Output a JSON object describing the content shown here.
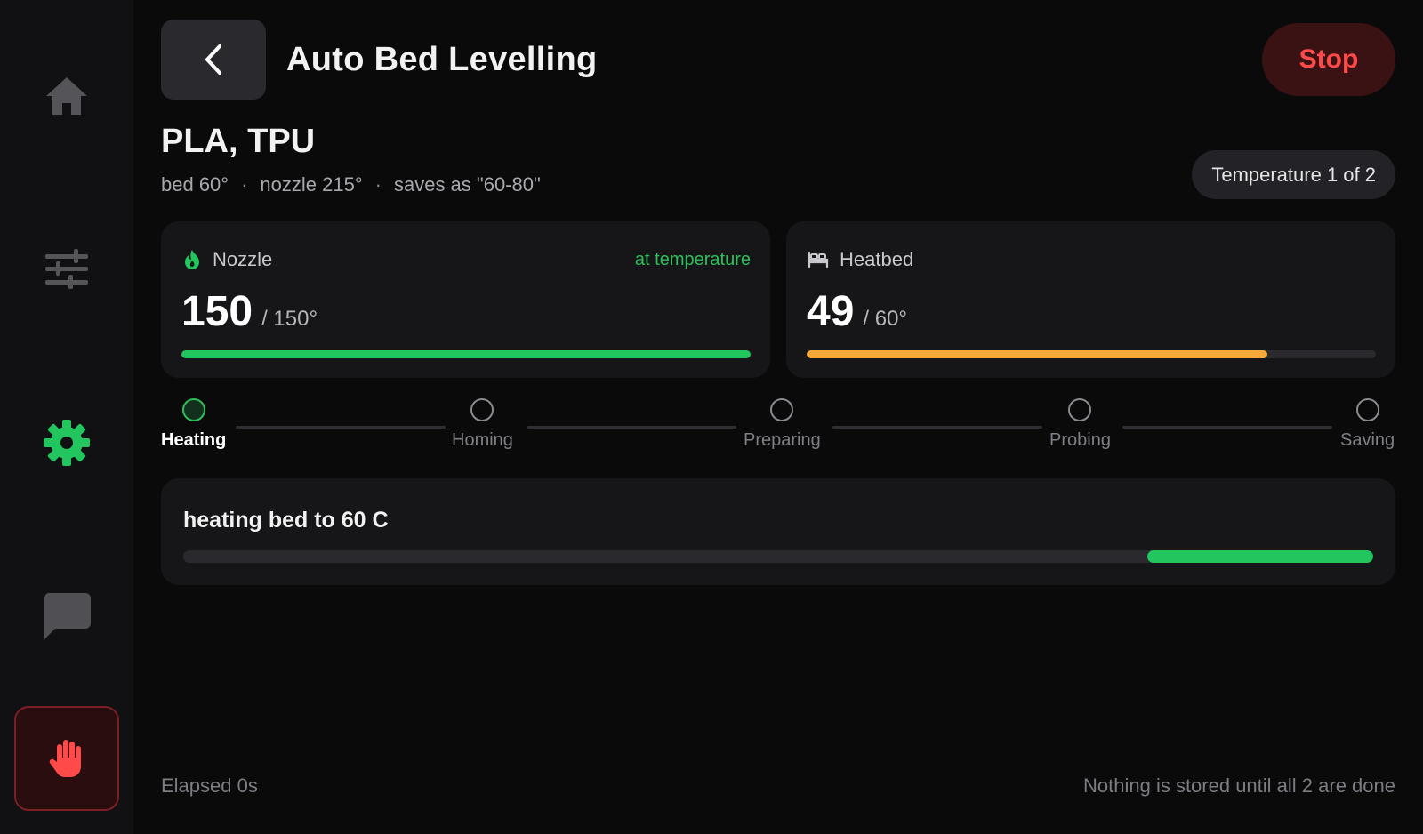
{
  "header": {
    "title": "Auto Bed Levelling",
    "stop_label": "Stop"
  },
  "sidebar": {
    "items": [
      {
        "icon": "home-icon"
      },
      {
        "icon": "sliders-icon"
      },
      {
        "icon": "gear-icon",
        "active": true
      },
      {
        "icon": "chat-icon"
      },
      {
        "icon": "hand-stop-icon"
      }
    ]
  },
  "profile": {
    "name": "PLA, TPU",
    "bed": "bed 60°",
    "nozzle": "nozzle 215°",
    "saves_as": "saves as \"60-80\"",
    "temperature_index": "Temperature 1 of 2"
  },
  "nozzle": {
    "label": "Nozzle",
    "status": "at temperature",
    "current": "150",
    "target": "/ 150°",
    "progress": 1.0,
    "color": "#22c55e"
  },
  "heatbed": {
    "label": "Heatbed",
    "status": "",
    "current": "49",
    "target": "/ 60°",
    "progress": 0.81,
    "color": "#f4a93a"
  },
  "steps": [
    {
      "label": "Heating",
      "active": true
    },
    {
      "label": "Homing",
      "active": false
    },
    {
      "label": "Preparing",
      "active": false
    },
    {
      "label": "Probing",
      "active": false
    },
    {
      "label": "Saving",
      "active": false
    }
  ],
  "task": {
    "message": "heating bed to 60 C",
    "progress_start": 0.81,
    "progress_end": 1.0
  },
  "footer": {
    "elapsed": "Elapsed 0s",
    "note": "Nothing is stored until all 2 are done"
  },
  "colors": {
    "accent": "#22c55e",
    "danger": "#ff4a4a",
    "warning": "#f4a93a"
  }
}
